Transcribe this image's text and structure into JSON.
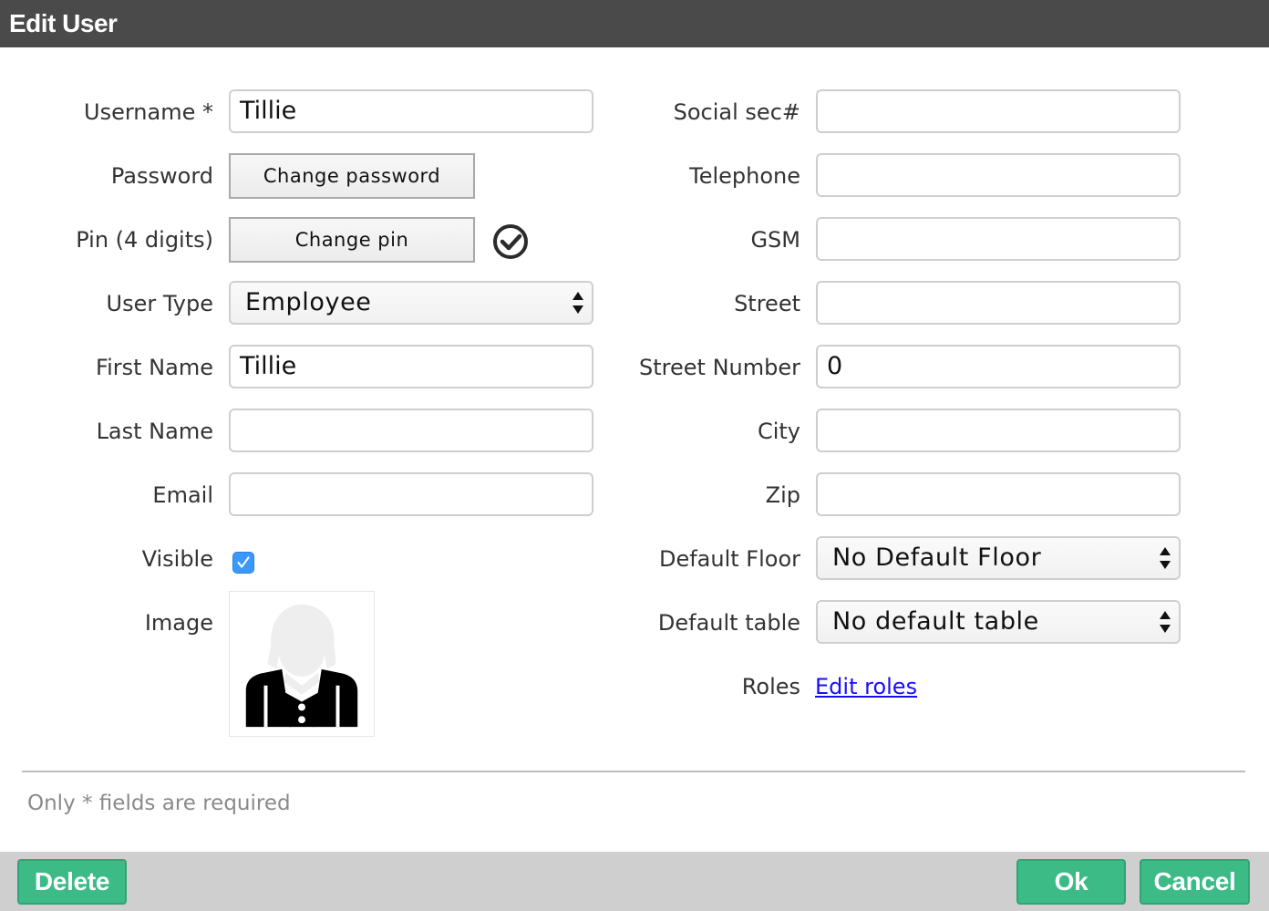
{
  "window": {
    "title": "Edit User"
  },
  "left_form": {
    "username": {
      "label": "Username *",
      "value": "Tillie"
    },
    "password": {
      "label": "Password",
      "button": "Change password"
    },
    "pin": {
      "label": "Pin (4 digits)",
      "button": "Change pin",
      "status_icon": "check-circle-icon"
    },
    "user_type": {
      "label": "User Type",
      "selected": "Employee"
    },
    "first_name": {
      "label": "First Name",
      "value": "Tillie"
    },
    "last_name": {
      "label": "Last Name",
      "value": ""
    },
    "email": {
      "label": "Email",
      "value": ""
    },
    "visible": {
      "label": "Visible",
      "checked": true
    },
    "image": {
      "label": "Image",
      "icon": "user-avatar-icon"
    }
  },
  "right_form": {
    "social_sec": {
      "label": "Social sec#",
      "value": ""
    },
    "telephone": {
      "label": "Telephone",
      "value": ""
    },
    "gsm": {
      "label": "GSM",
      "value": ""
    },
    "street": {
      "label": "Street",
      "value": ""
    },
    "street_number": {
      "label": "Street Number",
      "value": "0"
    },
    "city": {
      "label": "City",
      "value": ""
    },
    "zip": {
      "label": "Zip",
      "value": ""
    },
    "default_floor": {
      "label": "Default Floor",
      "selected": "No Default Floor"
    },
    "default_table": {
      "label": "Default table",
      "selected": "No default table"
    },
    "roles": {
      "label": "Roles",
      "link": "Edit roles"
    }
  },
  "hint": "Only * fields are required",
  "footer": {
    "delete": "Delete",
    "ok": "Ok",
    "cancel": "Cancel"
  },
  "colors": {
    "titlebar": "#4a4a4a",
    "accent_green": "#3dbb87",
    "link": "#1a0dff",
    "checkbox": "#3b99fc"
  }
}
